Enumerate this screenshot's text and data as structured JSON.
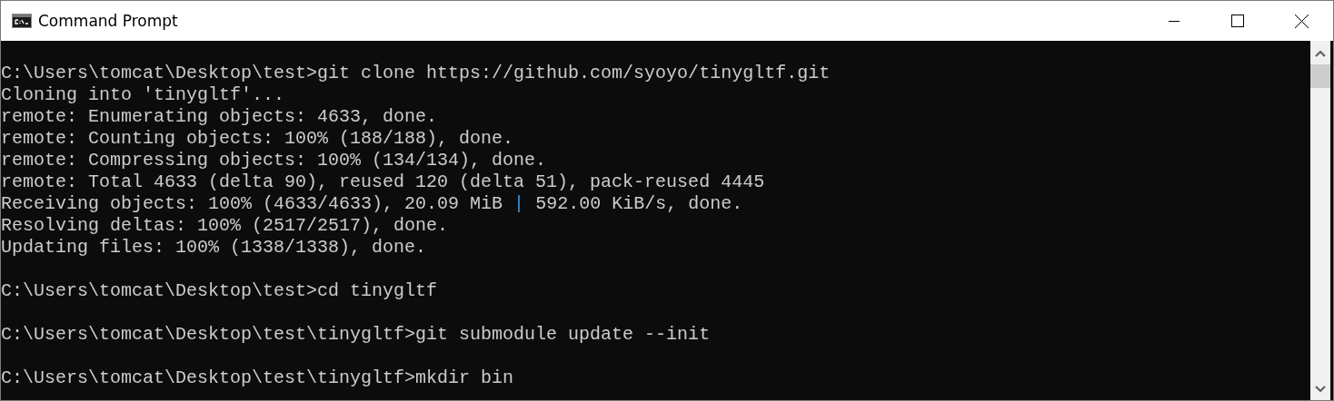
{
  "window": {
    "title": "Command Prompt"
  },
  "console": {
    "lines": [
      {
        "kind": "text",
        "text": "C:\\Users\\tomcat\\Desktop\\test>git clone https://github.com/syoyo/tinygltf.git"
      },
      {
        "kind": "text",
        "text": "Cloning into 'tinygltf'..."
      },
      {
        "kind": "text",
        "text": "remote: Enumerating objects: 4633, done."
      },
      {
        "kind": "text",
        "text": "remote: Counting objects: 100% (188/188), done."
      },
      {
        "kind": "text",
        "text": "remote: Compressing objects: 100% (134/134), done."
      },
      {
        "kind": "text",
        "text": "remote: Total 4633 (delta 90), reused 120 (delta 51), pack-reused 4445"
      },
      {
        "kind": "split",
        "before": "Receiving objects: 100% (4633/4633), 20.09 MiB",
        "separator": "|",
        "after": "592.00 KiB/s, done."
      },
      {
        "kind": "text",
        "text": "Resolving deltas: 100% (2517/2517), done."
      },
      {
        "kind": "text",
        "text": "Updating files: 100% (1338/1338), done."
      },
      {
        "kind": "blank"
      },
      {
        "kind": "text",
        "text": "C:\\Users\\tomcat\\Desktop\\test>cd tinygltf"
      },
      {
        "kind": "blank"
      },
      {
        "kind": "text",
        "text": "C:\\Users\\tomcat\\Desktop\\test\\tinygltf>git submodule update --init"
      },
      {
        "kind": "blank"
      },
      {
        "kind": "text",
        "text": "C:\\Users\\tomcat\\Desktop\\test\\tinygltf>mkdir bin"
      }
    ]
  }
}
